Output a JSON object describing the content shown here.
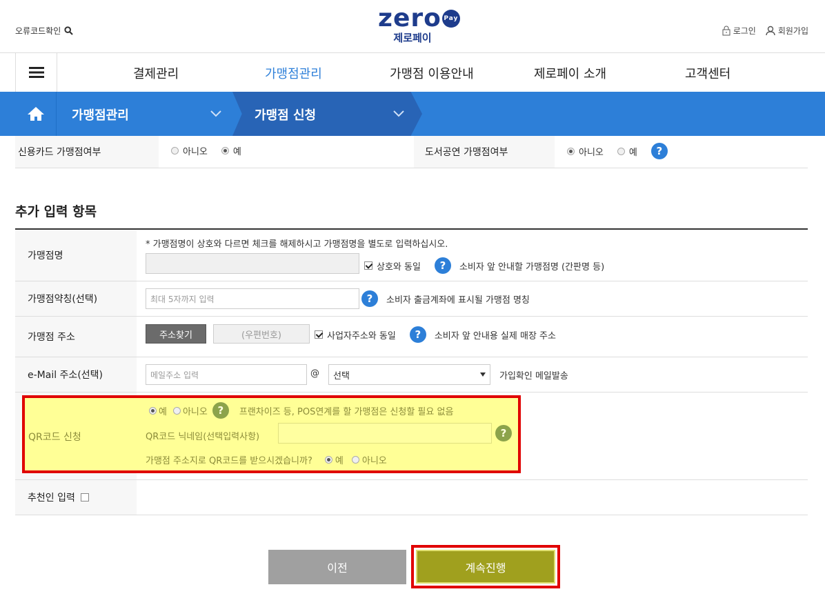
{
  "header": {
    "error_check": "오류코드확인",
    "logo_main": "zero",
    "logo_pay": "Pay",
    "logo_kr": "제로페이",
    "login": "로그인",
    "signup": "회원가입"
  },
  "gnb": {
    "items": [
      {
        "label": "결제관리"
      },
      {
        "label": "가맹점관리"
      },
      {
        "label": "가맹점 이용안내"
      },
      {
        "label": "제로페이 소개"
      },
      {
        "label": "고객센터"
      }
    ]
  },
  "location": {
    "level1": "가맹점관리",
    "level2": "가맹점 신청"
  },
  "top_row": {
    "credit_label": "신용카드 가맹점여부",
    "credit_no": "아니오",
    "credit_yes": "예",
    "book_label": "도서공연 가맹점여부",
    "book_no": "아니오",
    "book_yes": "예"
  },
  "section": {
    "title": "추가 입력 항목"
  },
  "form": {
    "store_name_label": "가맹점명",
    "store_name_note": "* 가맹점명이 상호와 다르면 체크를 해제하시고 가맹점명을 별도로 입력하십시오.",
    "same_as_company": "상호와 동일",
    "store_name_help": "소비자 앞 안내할 가맹점명 (간판명 등)",
    "abbr_label": "가맹점약칭(선택)",
    "abbr_placeholder": "최대 5자까지 입력",
    "abbr_help": "소비자 출금계좌에 표시될 가맹점 명칭",
    "addr_label": "가맹점 주소",
    "addr_button": "주소찾기",
    "zip_placeholder": "(우편번호)",
    "same_as_biz_addr": "사업자주소와 동일",
    "addr_help": "소비자 앞 안내용 실제 매장 주소",
    "email_label": "e-Mail 주소(선택)",
    "email_placeholder": "메일주소 입력",
    "at": "@",
    "email_select": "선택",
    "email_note": "가입확인 메일발송",
    "qr_label": "QR코드 신청",
    "qr_yes": "예",
    "qr_no": "아니오",
    "qr_note": "프랜차이즈 등, POS연계를 할 가맹점은 신청할 필요 없음",
    "qr_nick_label": "QR코드 닉네임(선택입력사항)",
    "qr_addr_q": "가맹점 주소지로 QR코드를 받으시겠습니까?",
    "qr_addr_yes": "예",
    "qr_addr_no": "아니오",
    "referrer_label": "추천인 입력"
  },
  "buttons": {
    "prev": "이전",
    "next": "계속진행"
  },
  "colors": {
    "brand_blue": "#2d7fd8",
    "logo_navy": "#1e3c8c",
    "highlight_yellow": "#ffff96",
    "highlight_red": "#e00000",
    "next_olive": "#a0a01e"
  }
}
